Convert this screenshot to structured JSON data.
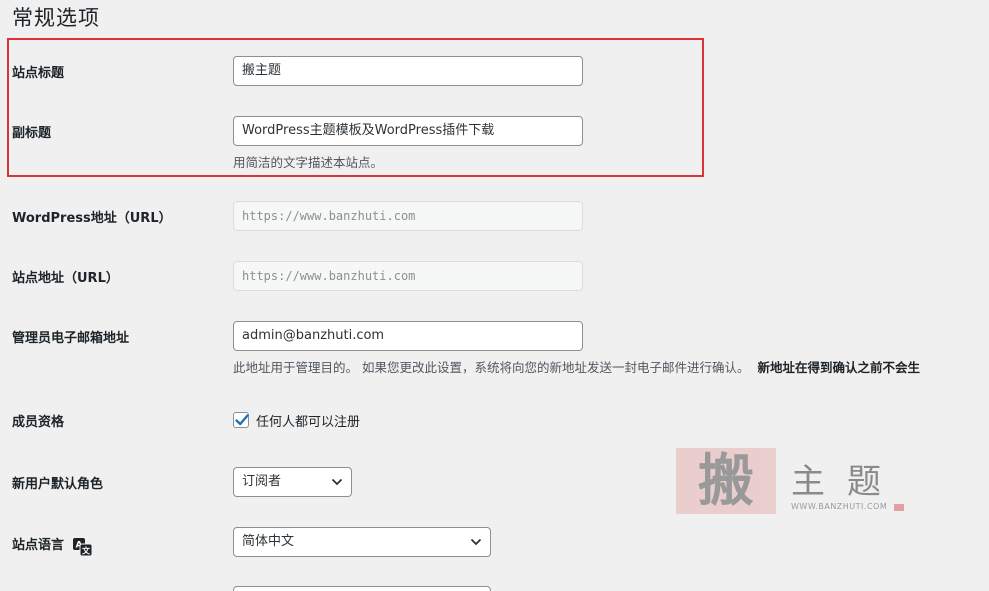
{
  "page": {
    "title": "常规选项"
  },
  "fields": {
    "site_title": {
      "label": "站点标题",
      "value": "搬主题"
    },
    "tagline": {
      "label": "副标题",
      "value": "WordPress主题模板及WordPress插件下载",
      "description": "用简洁的文字描述本站点。"
    },
    "wp_address": {
      "label": "WordPress地址（URL）",
      "value": "https://www.banzhuti.com"
    },
    "site_address": {
      "label": "站点地址（URL）",
      "value": "https://www.banzhuti.com"
    },
    "admin_email": {
      "label": "管理员电子邮箱地址",
      "value": "admin@banzhuti.com",
      "description": "此地址用于管理目的。 如果您更改此设置，系统将向您的新地址发送一封电子邮件进行确认。",
      "description_bold": "新地址在得到确认之前不会生"
    },
    "membership": {
      "label": "成员资格",
      "checkbox_label": "任何人都可以注册",
      "checked": true
    },
    "default_role": {
      "label": "新用户默认角色",
      "selected": "订阅者"
    },
    "site_language": {
      "label": "站点语言",
      "selected": "简体中文",
      "icon": "translation-icon"
    }
  },
  "watermark": {
    "big_char": "搬",
    "chars": "主题",
    "url": "WWW.BANZHUTI.COM"
  },
  "colors": {
    "highlight": "#d63638",
    "checkbox_accent": "#2271b1"
  }
}
